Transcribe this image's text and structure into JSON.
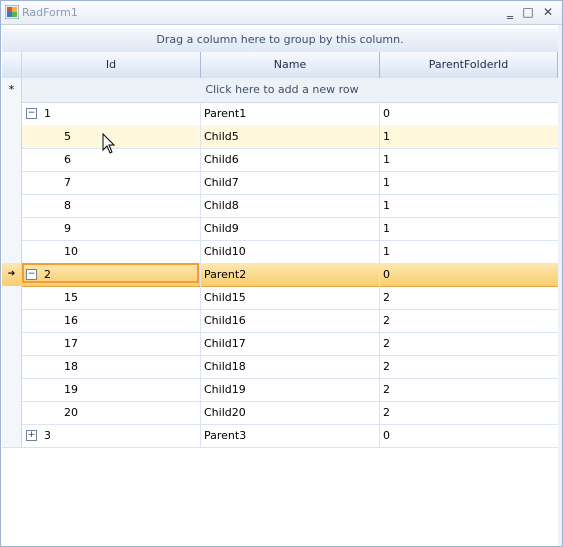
{
  "window": {
    "title": "RadForm1",
    "minimize_glyph": "‗",
    "maximize_glyph": "□",
    "close_glyph": "✕"
  },
  "grid": {
    "group_panel_text": "Drag a column here to group by this column.",
    "columns": [
      "Id",
      "Name",
      "ParentFolderId"
    ],
    "new_row_text": "Click here to add a new row",
    "new_row_glyph": "*",
    "current_row_glyph": "➔",
    "rows": [
      {
        "id": "1",
        "name": "Parent1",
        "parent": "0",
        "level": 0,
        "expander": "−"
      },
      {
        "id": "5",
        "name": "Child5",
        "parent": "1",
        "level": 1
      },
      {
        "id": "6",
        "name": "Child6",
        "parent": "1",
        "level": 1
      },
      {
        "id": "7",
        "name": "Child7",
        "parent": "1",
        "level": 1
      },
      {
        "id": "8",
        "name": "Child8",
        "parent": "1",
        "level": 1
      },
      {
        "id": "9",
        "name": "Child9",
        "parent": "1",
        "level": 1
      },
      {
        "id": "10",
        "name": "Child10",
        "parent": "1",
        "level": 1
      },
      {
        "id": "2",
        "name": "Parent2",
        "parent": "0",
        "level": 0,
        "expander": "−"
      },
      {
        "id": "15",
        "name": "Child15",
        "parent": "2",
        "level": 1
      },
      {
        "id": "16",
        "name": "Child16",
        "parent": "2",
        "level": 1
      },
      {
        "id": "17",
        "name": "Child17",
        "parent": "2",
        "level": 1
      },
      {
        "id": "18",
        "name": "Child18",
        "parent": "2",
        "level": 1
      },
      {
        "id": "19",
        "name": "Child19",
        "parent": "2",
        "level": 1
      },
      {
        "id": "20",
        "name": "Child20",
        "parent": "2",
        "level": 1
      },
      {
        "id": "3",
        "name": "Parent3",
        "parent": "0",
        "level": 0,
        "expander": "+"
      }
    ],
    "hover_row_index": 1,
    "current_row_index": 7
  },
  "colors": {
    "current_row": "#f9cd6e",
    "current_cell_border": "#f39b34",
    "hover_row": "#fff8dc",
    "header": "#d9e4f3"
  }
}
